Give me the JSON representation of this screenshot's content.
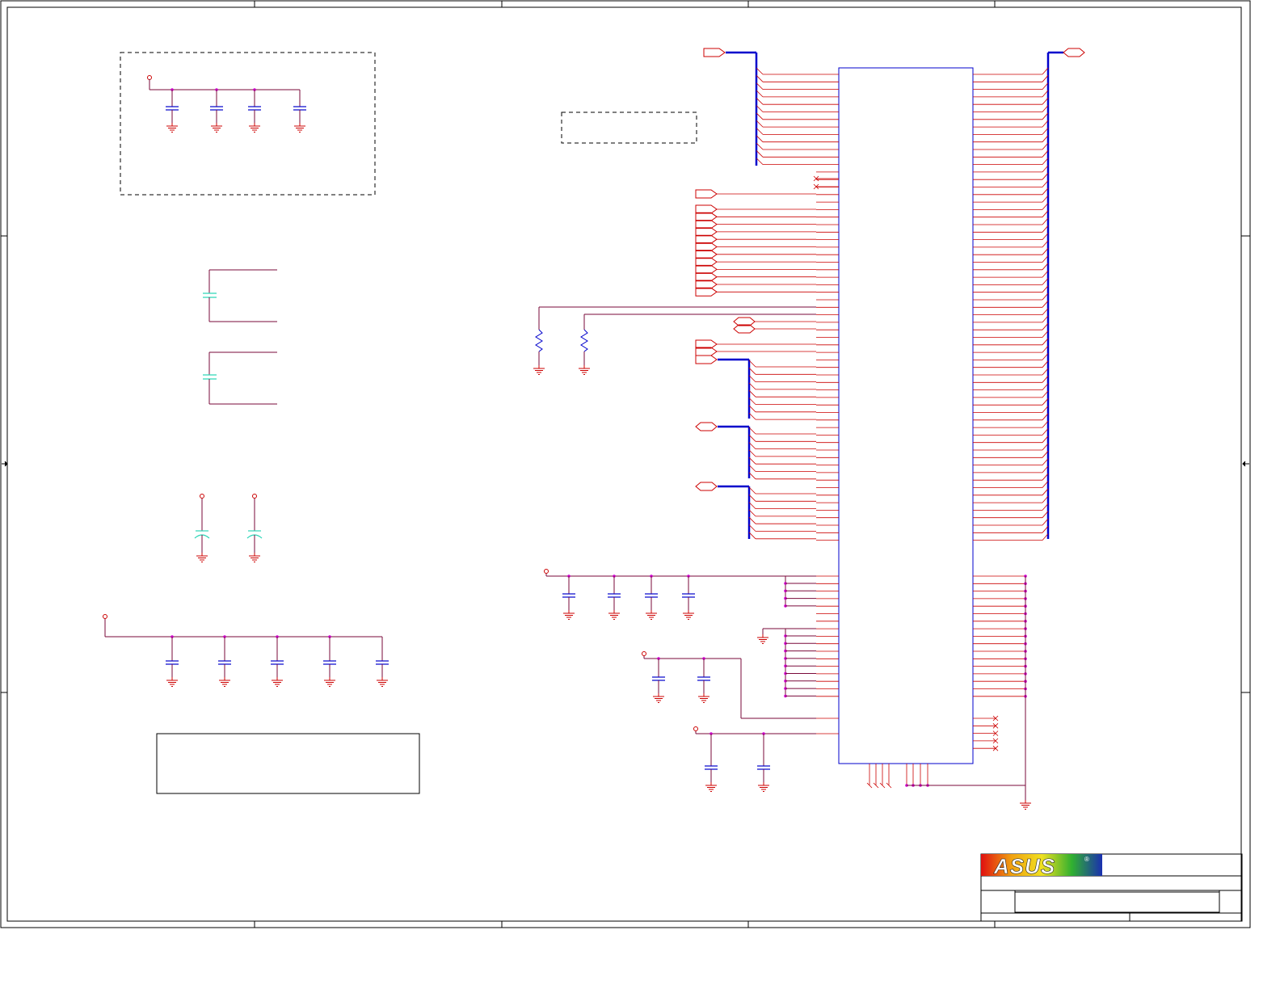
{
  "title_block": {
    "logo_text": "ASUS",
    "registered_mark": "®"
  },
  "colors": {
    "frame": "#000000",
    "net_wire": "#7a0a3a",
    "pin_stub": "#cc0000",
    "bus": "#0000cc",
    "chip_outline": "#0000cc",
    "capacitor": "#0000cc",
    "polarized_cap": "#2fd6b8",
    "ground": "#cc0000",
    "junction": "#cc00cc",
    "port": "#cc0000",
    "logo_red": "#e01010",
    "logo_blue": "#1a2fb0",
    "logo_rainbow": [
      "#e01010",
      "#f0a010",
      "#f0e020",
      "#30b030",
      "#1a2fb0"
    ]
  },
  "sheet_zones": {
    "column_marks": 5,
    "row_marks": 4
  }
}
